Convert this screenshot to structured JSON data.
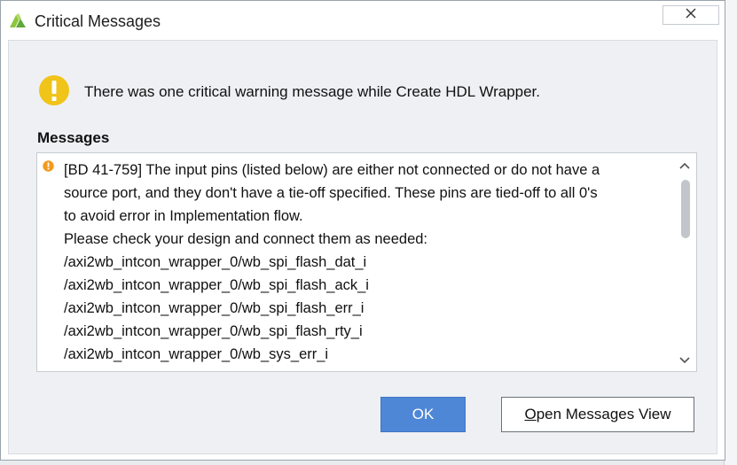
{
  "window": {
    "title": "Critical Messages",
    "close_icon": "close-icon"
  },
  "summary": {
    "text": "There was one critical warning message while Create HDL Wrapper.",
    "icon": "warning-icon",
    "icon_color": "#f0c419"
  },
  "messages": {
    "header": "Messages",
    "item_icon": "warning-dot-icon",
    "item_icon_color": "#f39a1e",
    "lines": [
      "[BD 41-759] The input pins (listed below) are either not connected or do not have a",
      "source port, and they don't have a tie-off specified. These pins are tied-off to all 0's",
      "to avoid error in Implementation flow.",
      "Please check your design and connect them as needed:",
      "/axi2wb_intcon_wrapper_0/wb_spi_flash_dat_i",
      "/axi2wb_intcon_wrapper_0/wb_spi_flash_ack_i",
      "/axi2wb_intcon_wrapper_0/wb_spi_flash_err_i",
      "/axi2wb_intcon_wrapper_0/wb_spi_flash_rty_i",
      "/axi2wb_intcon_wrapper_0/wb_sys_err_i"
    ]
  },
  "buttons": {
    "ok_label": "OK",
    "open_mnemonic": "O",
    "open_rest": "pen Messages View"
  },
  "colors": {
    "accent": "#4e87d6"
  }
}
